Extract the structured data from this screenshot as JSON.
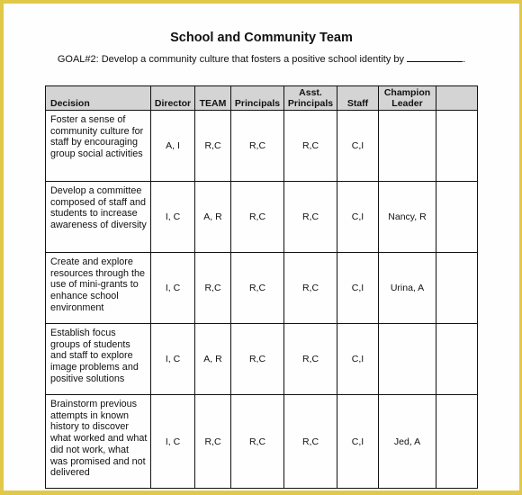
{
  "document": {
    "title": "School and Community Team",
    "goal_text": "GOAL#2: Develop a community culture that fosters a positive school identity by",
    "goal_end": "."
  },
  "table": {
    "headers": [
      "Decision",
      "Director",
      "TEAM",
      "Principals",
      "Asst. Principals",
      "Staff",
      "Champion Leader",
      ""
    ],
    "rows": [
      {
        "decision": "Foster a sense of community culture for staff by encouraging group social activities",
        "director": "A, I",
        "team": "R,C",
        "principals": "R,C",
        "asst_principals": "R,C",
        "staff": "C,I",
        "champion_leader": "",
        "extra": ""
      },
      {
        "decision": "Develop a committee composed of staff and students to increase awareness of diversity",
        "director": "I, C",
        "team": "A, R",
        "principals": "R,C",
        "asst_principals": "R,C",
        "staff": "C,I",
        "champion_leader": "Nancy, R",
        "extra": ""
      },
      {
        "decision": "Create and explore resources through the use of mini-grants to enhance school environment",
        "director": "I, C",
        "team": "R,C",
        "principals": "R,C",
        "asst_principals": "R,C",
        "staff": "C,I",
        "champion_leader": "Urina, A",
        "extra": ""
      },
      {
        "decision": "Establish focus groups of students and staff to explore image problems and positive solutions",
        "director": "I, C",
        "team": "A, R",
        "principals": "R,C",
        "asst_principals": "R,C",
        "staff": "C,I",
        "champion_leader": "",
        "extra": ""
      },
      {
        "decision": "Brainstorm previous attempts in known history to discover what worked and what did not work, what was promised and not delivered",
        "director": "I, C",
        "team": "R,C",
        "principals": "R,C",
        "asst_principals": "R,C",
        "staff": "C,I",
        "champion_leader": "Jed, A",
        "extra": ""
      }
    ]
  },
  "colors": {
    "frame": "#e2c84a",
    "header_bg": "#d4d4d4"
  }
}
